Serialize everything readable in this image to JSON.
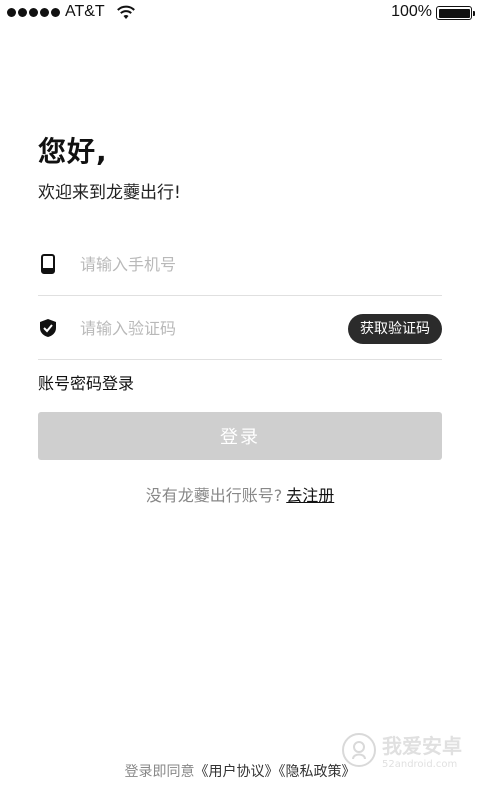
{
  "status_bar": {
    "carrier": "AT&T",
    "battery_text": "100%",
    "battery_level": 1.0,
    "signal_bars": 5
  },
  "greeting": {
    "title": "您好,",
    "subtitle": "欢迎来到龙虁出行!"
  },
  "phone_field": {
    "placeholder": "请输入手机号",
    "icon": "phone-icon"
  },
  "code_field": {
    "placeholder": "请输入验证码",
    "icon": "shield-check-icon",
    "get_code_label": "获取验证码"
  },
  "password_login_label": "账号密码登录",
  "login_button_label": "登录",
  "register": {
    "question": "没有龙虁出行账号?",
    "link": "去注册"
  },
  "agreement": {
    "prefix": "登录即同意",
    "user_agreement": "《用户协议》",
    "privacy_policy": "《隐私政策》"
  },
  "watermark": {
    "title": "我爱安卓",
    "url": "52android.com"
  },
  "colors": {
    "primary_dark": "#2b2b2b",
    "login_button_disabled": "#cfcfcf",
    "placeholder": "#b9b9b9"
  }
}
